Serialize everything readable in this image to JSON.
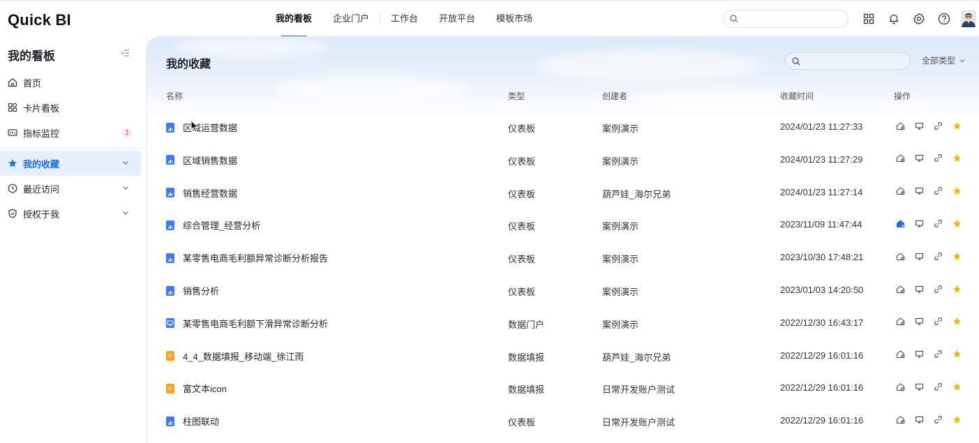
{
  "app": {
    "logo_main": "Quick B",
    "logo_tail": "I"
  },
  "nav": {
    "items": [
      {
        "label": "我的看板",
        "active": true
      },
      {
        "label": "企业门户",
        "active": false
      },
      {
        "label": "工作台",
        "active": false
      },
      {
        "label": "开放平台",
        "active": false
      },
      {
        "label": "模板市场",
        "active": false
      }
    ],
    "search_placeholder": ""
  },
  "sidebar": {
    "title": "我的看板",
    "items": [
      {
        "label": "首页",
        "icon": "home-icon"
      },
      {
        "label": "卡片看板",
        "icon": "grid-icon"
      },
      {
        "label": "指标监控",
        "icon": "monitor-icon",
        "badge": "1"
      },
      {
        "label": "我的收藏",
        "icon": "star-icon",
        "active": true
      },
      {
        "label": "最近访问",
        "icon": "clock-icon"
      },
      {
        "label": "授权于我",
        "icon": "shield-icon"
      }
    ]
  },
  "main": {
    "title": "我的收藏",
    "search_placeholder": "",
    "type_filter": "全部类型",
    "columns": {
      "name": "名称",
      "type": "类型",
      "creator": "创建者",
      "time": "收藏时间",
      "ops": "操作"
    },
    "rows": [
      {
        "name": "区域运营数据",
        "type": "仪表板",
        "creator": "案例演示",
        "time": "2024/01/23 11:27:33",
        "kind": "dash",
        "published": false
      },
      {
        "name": "区域销售数据",
        "type": "仪表板",
        "creator": "案例演示",
        "time": "2024/01/23 11:27:29",
        "kind": "dash",
        "published": false
      },
      {
        "name": "销售经营数据",
        "type": "仪表板",
        "creator": "葫芦娃_海尔兄弟",
        "time": "2024/01/23 11:27:14",
        "kind": "dash",
        "published": false
      },
      {
        "name": "综合管理_经营分析",
        "type": "仪表板",
        "creator": "案例演示",
        "time": "2023/11/09 11:47:44",
        "kind": "dash",
        "published": true
      },
      {
        "name": "某零售电商毛利额异常诊断分析报告",
        "type": "仪表板",
        "creator": "案例演示",
        "time": "2023/10/30 17:48:21",
        "kind": "dash",
        "published": false
      },
      {
        "name": "销售分析",
        "type": "仪表板",
        "creator": "案例演示",
        "time": "2023/01/03 14:20:50",
        "kind": "dash",
        "published": false
      },
      {
        "name": "某零售电商毛利额下滑异常诊断分析",
        "type": "数据门户",
        "creator": "案例演示",
        "time": "2022/12/30 16:43:17",
        "kind": "portal",
        "published": false
      },
      {
        "name": "4_4_数据填报_移动端_徐江雨",
        "type": "数据填报",
        "creator": "葫芦娃_海尔兄弟",
        "time": "2022/12/29 16:01:16",
        "kind": "form",
        "published": false
      },
      {
        "name": "富文本icon",
        "type": "数据填报",
        "creator": "日常开发账户测试",
        "time": "2022/12/29 16:01:16",
        "kind": "form",
        "published": false
      },
      {
        "name": "柱图联动",
        "type": "仪表板",
        "creator": "日常开发账户测试",
        "time": "2022/12/29 16:01:16",
        "kind": "dash",
        "published": false
      }
    ]
  },
  "colors": {
    "accent": "#1b6ef3",
    "star": "#f7b500",
    "form": "#f6a524",
    "badge_text": "#e5484d"
  }
}
